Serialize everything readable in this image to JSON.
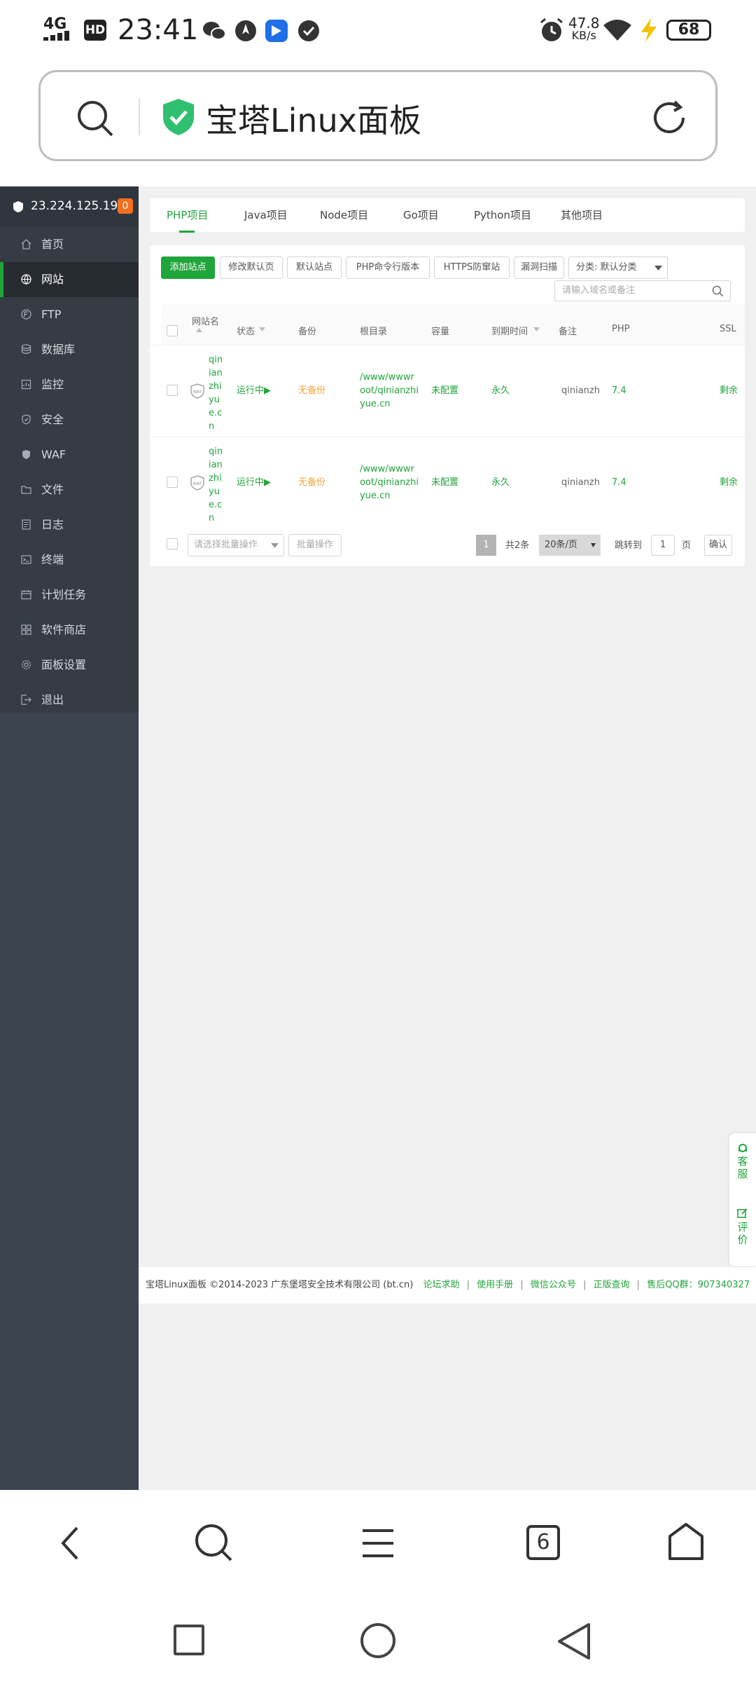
{
  "status_bar": {
    "network": "4G",
    "hd": "HD",
    "time": "23:41",
    "speed_value": "47.8",
    "speed_unit": "KB/s",
    "battery": "68"
  },
  "browser": {
    "title": "宝塔Linux面板",
    "tab_count": "6"
  },
  "sidebar": {
    "ip": "23.224.125.191",
    "badge": "0",
    "items": [
      {
        "label": "首页"
      },
      {
        "label": "网站"
      },
      {
        "label": "FTP"
      },
      {
        "label": "数据库"
      },
      {
        "label": "监控"
      },
      {
        "label": "安全"
      },
      {
        "label": "WAF"
      },
      {
        "label": "文件"
      },
      {
        "label": "日志"
      },
      {
        "label": "终端"
      },
      {
        "label": "计划任务"
      },
      {
        "label": "软件商店"
      },
      {
        "label": "面板设置"
      },
      {
        "label": "退出"
      }
    ]
  },
  "tabs": [
    "PHP项目",
    "Java项目",
    "Node项目",
    "Go项目",
    "Python项目",
    "其他项目"
  ],
  "toolbar": {
    "add_site": "添加站点",
    "edit_default": "修改默认页",
    "default_site": "默认站点",
    "php_cli": "PHP命令行版本",
    "https_protect": "HTTPS防窜站",
    "vuln_scan": "漏洞扫描",
    "category": "分类: 默认分类",
    "search_placeholder": "请输入域名或备注"
  },
  "table": {
    "headers": {
      "name": "网站名",
      "status": "状态",
      "backup": "备份",
      "root": "根目录",
      "capacity": "容量",
      "expiry": "到期时间",
      "remark": "备注",
      "php": "PHP",
      "ssl": "SSL"
    },
    "rows": [
      {
        "name_lines": [
          "qin",
          "ian",
          "zhi",
          "yu",
          "e.c",
          "n"
        ],
        "status": "运行中▶",
        "backup": "无备份",
        "root_lines": [
          "/www/wwwr",
          "oot/qinianzhi",
          "yue.cn"
        ],
        "capacity": "未配置",
        "expiry": "永久",
        "remark": "qinianzh",
        "php": "7.4",
        "ssl": "剩余"
      },
      {
        "name_lines": [
          "qin",
          "ian",
          "zhi",
          "yu",
          "e.c",
          "n"
        ],
        "status": "运行中▶",
        "backup": "无备份",
        "root_lines": [
          "/www/wwwr",
          "oot/qinianzhi",
          "yue.cn"
        ],
        "capacity": "未配置",
        "expiry": "永久",
        "remark": "qinianzh",
        "php": "7.4",
        "ssl": "剩余"
      }
    ]
  },
  "pagination": {
    "batch_placeholder": "请选择批量操作",
    "batch_button": "批量操作",
    "current_page": "1",
    "total": "共2条",
    "per_page": "20条/页",
    "jump_label": "跳转到",
    "jump_value": "1",
    "page_unit": "页",
    "confirm": "确认"
  },
  "float_help": {
    "service": [
      "客",
      "服"
    ],
    "review": [
      "评",
      "价"
    ]
  },
  "footer": {
    "copyright": "宝塔Linux面板 ©2014-2023 广东堡塔安全技术有限公司 (bt.cn)",
    "links": [
      "论坛求助",
      "使用手册",
      "微信公众号",
      "正版查询"
    ],
    "qq": "售后QQ群：907340327"
  },
  "colors": {
    "brand_green": "#20a53a",
    "sidebar_bg": "#3c444d",
    "warning_orange": "#f0a541"
  }
}
